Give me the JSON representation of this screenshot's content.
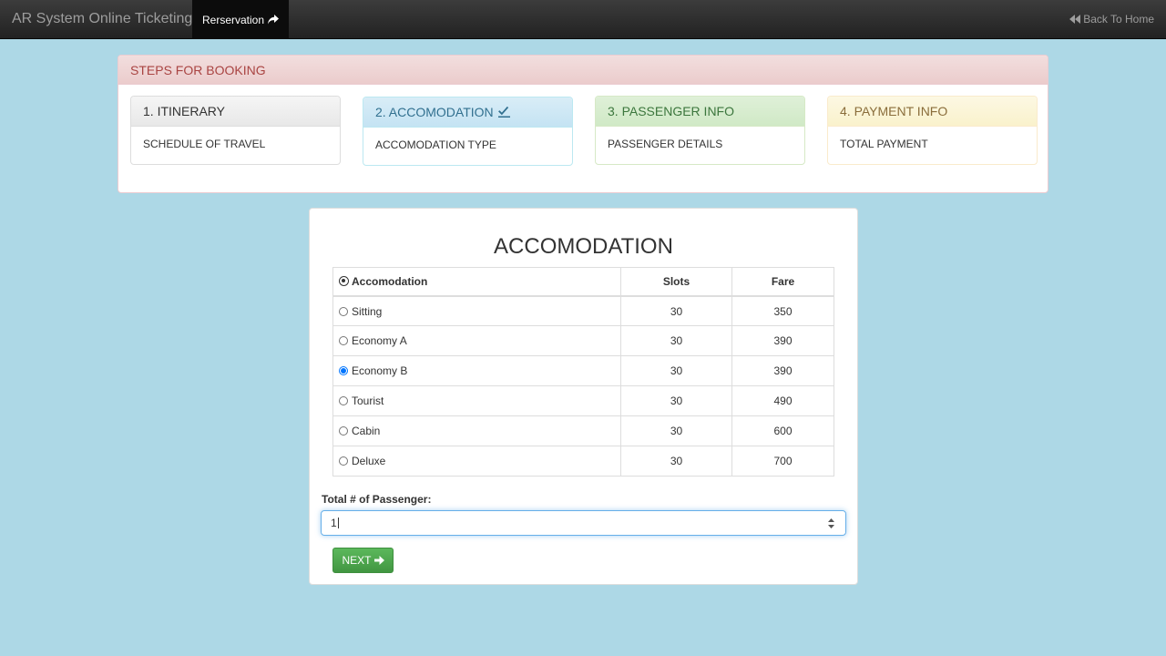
{
  "navbar": {
    "brand": "AR System Online Ticketing",
    "active_item": "Rerservation",
    "back_home": "Back To Home"
  },
  "steps": {
    "heading": "STEPS FOR BOOKING",
    "items": [
      {
        "title": "1. ITINERARY",
        "body": "SCHEDULE OF TRAVEL"
      },
      {
        "title": "2. ACCOMODATION",
        "body": "ACCOMODATION TYPE"
      },
      {
        "title": "3. PASSENGER INFO",
        "body": "PASSENGER DETAILS"
      },
      {
        "title": "4. PAYMENT INFO",
        "body": "TOTAL PAYMENT"
      }
    ]
  },
  "main": {
    "title": "ACCOMODATION",
    "table": {
      "headers": [
        "Accomodation",
        "Slots",
        "Fare"
      ],
      "rows": [
        {
          "name": "Sitting",
          "slots": "30",
          "fare": "350",
          "selected": false
        },
        {
          "name": "Economy A",
          "slots": "30",
          "fare": "390",
          "selected": false
        },
        {
          "name": "Economy B",
          "slots": "30",
          "fare": "390",
          "selected": true
        },
        {
          "name": "Tourist",
          "slots": "30",
          "fare": "490",
          "selected": false
        },
        {
          "name": "Cabin",
          "slots": "30",
          "fare": "600",
          "selected": false
        },
        {
          "name": "Deluxe",
          "slots": "30",
          "fare": "700",
          "selected": false
        }
      ]
    },
    "passenger_label": "Total # of Passenger:",
    "passenger_value": "1",
    "next_label": "NEXT"
  }
}
